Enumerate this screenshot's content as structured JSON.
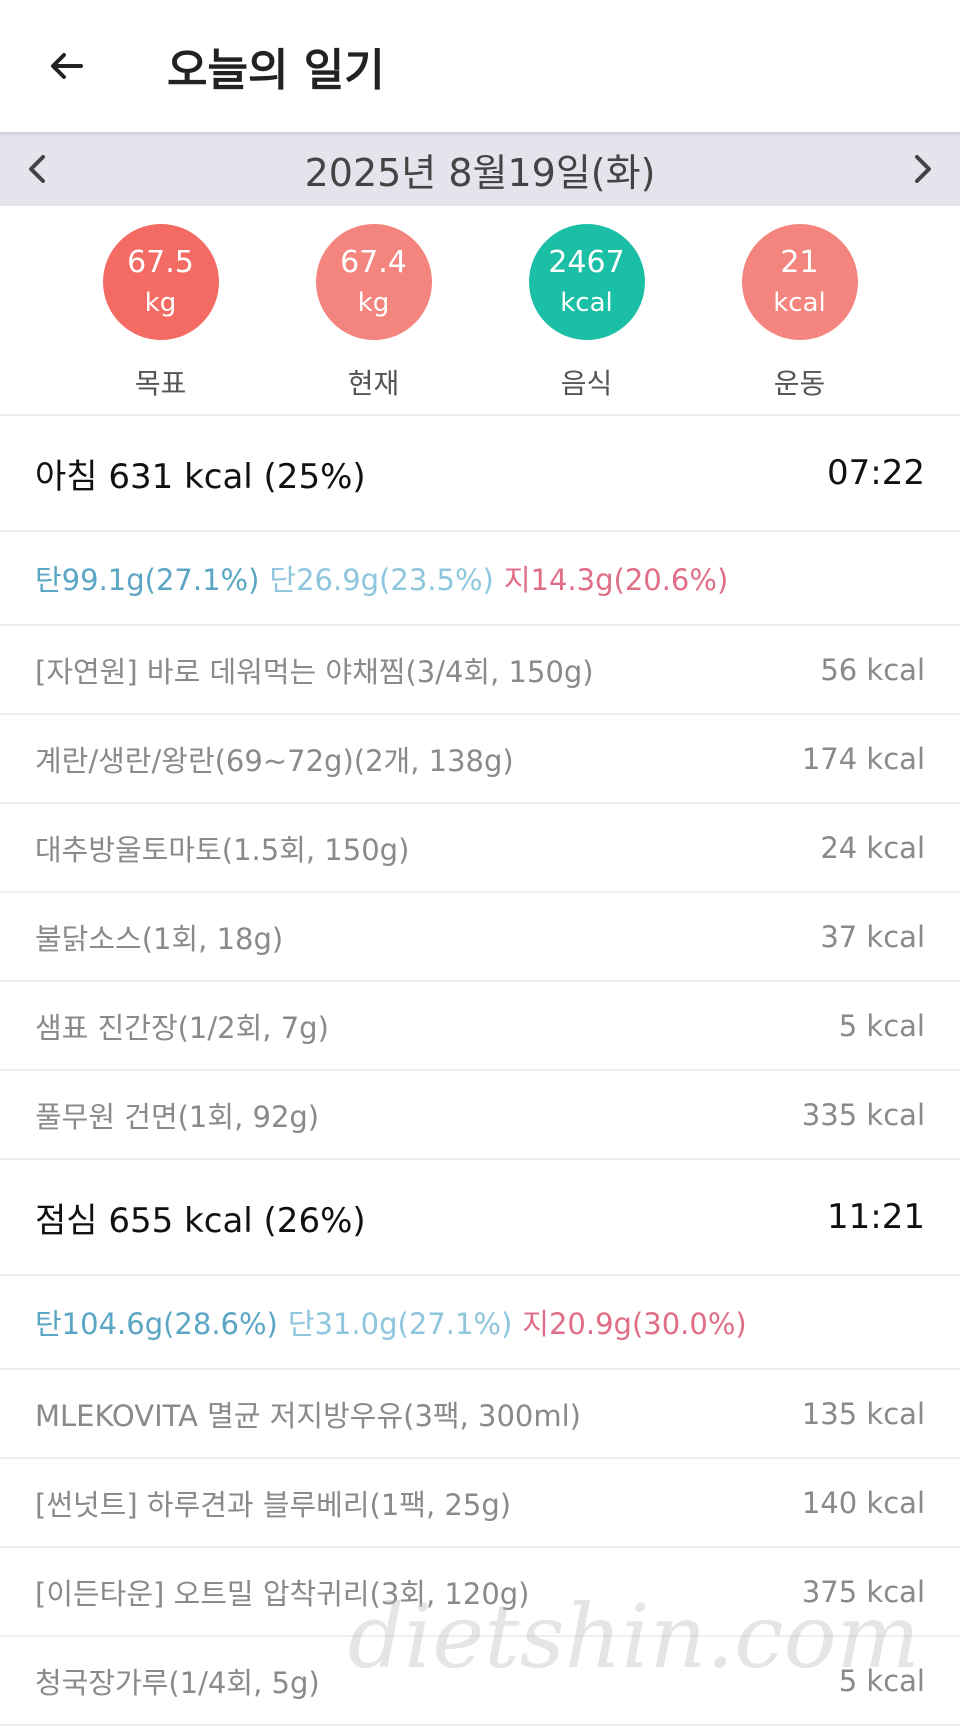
{
  "header": {
    "title": "오늘의 일기",
    "back_icon": "arrow-left-icon"
  },
  "datebar": {
    "date": "2025년 8월19일(화)",
    "prev_icon": "chevron-left-icon",
    "next_icon": "chevron-right-icon"
  },
  "stats": [
    {
      "value": "67.5",
      "unit": "kg",
      "label": "목표",
      "color": "#f46b63"
    },
    {
      "value": "67.4",
      "unit": "kg",
      "label": "현재",
      "color": "#f4857e"
    },
    {
      "value": "2467",
      "unit": "kcal",
      "label": "음식",
      "color": "#1bbfa6"
    },
    {
      "value": "21",
      "unit": "kcal",
      "label": "운동",
      "color": "#f4857e"
    }
  ],
  "meals": [
    {
      "title": "아침 631 kcal (25%)",
      "time": "07:22",
      "carb": "탄99.1g(27.1%)",
      "protein": "단26.9g(23.5%)",
      "fat": "지14.3g(20.6%)",
      "foods": [
        {
          "name": "[자연원] 바로 데워먹는 야채찜(3/4회, 150g)",
          "kcal": "56 kcal"
        },
        {
          "name": "계란/생란/왕란(69~72g)(2개, 138g)",
          "kcal": "174 kcal"
        },
        {
          "name": "대추방울토마토(1.5회, 150g)",
          "kcal": "24 kcal"
        },
        {
          "name": "불닭소스(1회, 18g)",
          "kcal": "37 kcal"
        },
        {
          "name": "샘표 진간장(1/2회, 7g)",
          "kcal": "5 kcal"
        },
        {
          "name": "풀무원 건면(1회, 92g)",
          "kcal": "335 kcal"
        }
      ]
    },
    {
      "title": "점심 655 kcal (26%)",
      "time": "11:21",
      "carb": "탄104.6g(28.6%)",
      "protein": "단31.0g(27.1%)",
      "fat": "지20.9g(30.0%)",
      "foods": [
        {
          "name": "MLEKOVITA 멸균 저지방우유(3팩, 300ml)",
          "kcal": "135 kcal"
        },
        {
          "name": "[썬넛트] 하루견과 블루베리(1팩, 25g)",
          "kcal": "140 kcal"
        },
        {
          "name": "[이든타운] 오트밀 압착귀리(3회, 120g)",
          "kcal": "375 kcal"
        },
        {
          "name": "청국장가루(1/4회, 5g)",
          "kcal": "5 kcal"
        }
      ]
    }
  ],
  "watermark": "dietshin.com"
}
